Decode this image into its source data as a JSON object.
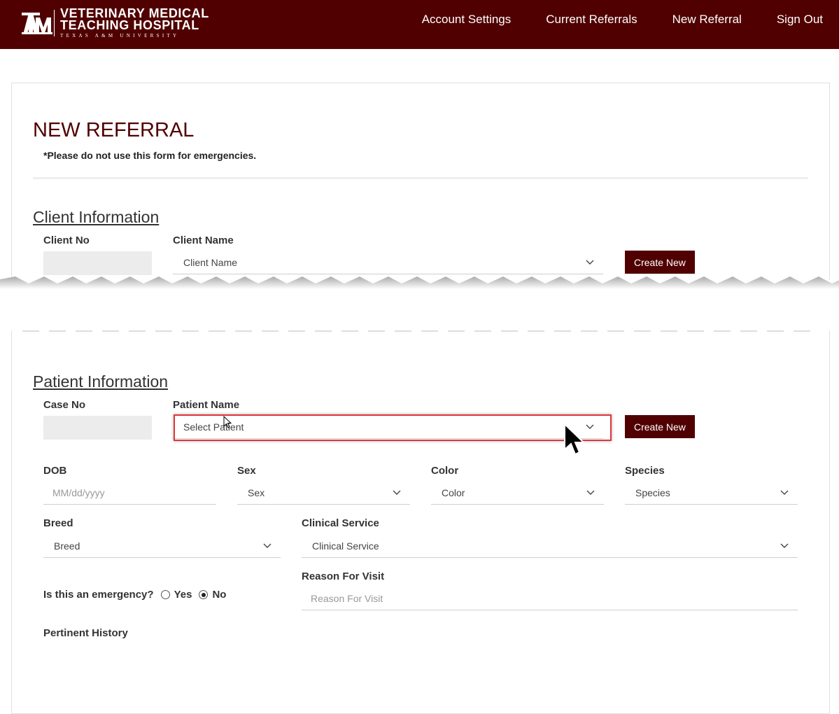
{
  "header": {
    "logo": {
      "mark": "ATM",
      "line1": "VETERINARY MEDICAL",
      "line2": "TEACHING HOSPITAL",
      "line3": "TEXAS A&M UNIVERSITY"
    },
    "nav": [
      "Account Settings",
      "Current Referrals",
      "New Referral",
      "Sign Out"
    ]
  },
  "page": {
    "title": "NEW REFERRAL",
    "warning": "*Please do not use this form for emergencies."
  },
  "client_section": {
    "title": "Client Information",
    "client_no_label": "Client No",
    "client_name_label": "Client Name",
    "client_name_placeholder": "Client Name",
    "create_new_label": "Create New"
  },
  "patient_section": {
    "title": "Patient Information",
    "case_no_label": "Case No",
    "patient_name_label": "Patient Name",
    "patient_name_placeholder": "Select Patient",
    "create_new_label": "Create New",
    "dob_label": "DOB",
    "dob_placeholder": "MM/dd/yyyy",
    "sex_label": "Sex",
    "sex_placeholder": "Sex",
    "color_label": "Color",
    "color_placeholder": "Color",
    "species_label": "Species",
    "species_placeholder": "Species",
    "breed_label": "Breed",
    "breed_placeholder": "Breed",
    "clinical_service_label": "Clinical Service",
    "clinical_service_placeholder": "Clinical Service",
    "reason_label": "Reason For Visit",
    "reason_placeholder": "Reason For Visit",
    "emergency_label": "Is this an emergency?",
    "emergency_yes": "Yes",
    "emergency_no": "No",
    "emergency_selected": "No",
    "pertinent_history_label": "Pertinent History"
  },
  "colors": {
    "brand": "#500000",
    "highlight": "#e0363a"
  }
}
